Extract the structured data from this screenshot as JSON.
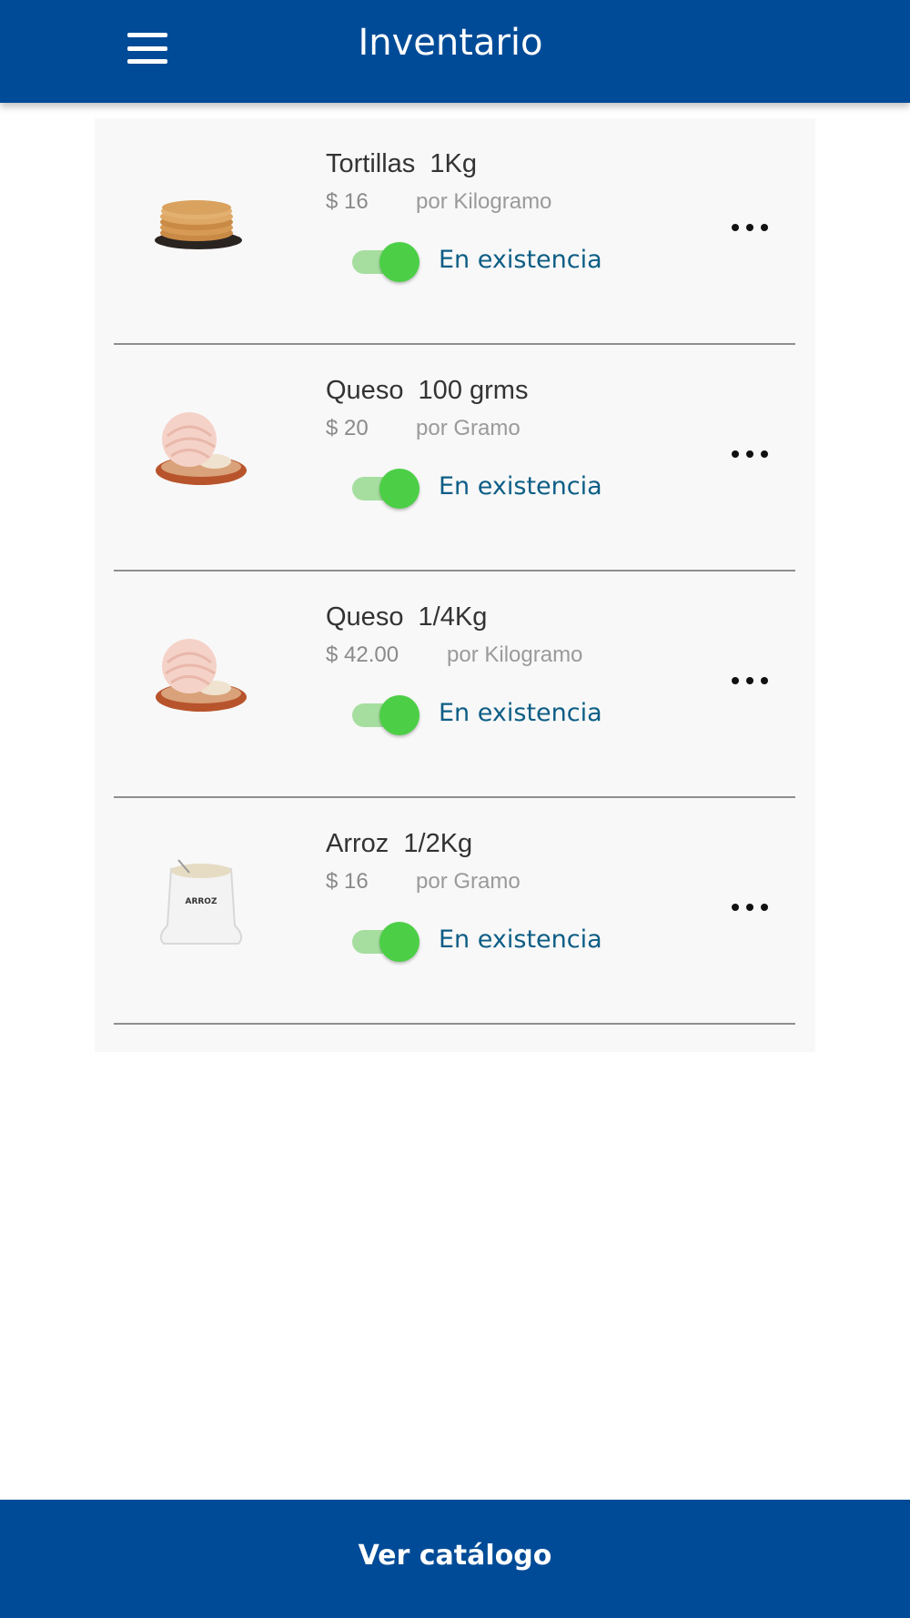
{
  "header": {
    "title": "Inventario",
    "menu_icon": "hamburger-menu-icon",
    "background": "#004b97"
  },
  "items": [
    {
      "name": "Tortillas  1Kg",
      "price": "$ 16",
      "unit": "por Kilogramo",
      "status": "En existencia",
      "in_stock": true,
      "image": "tortillas-image"
    },
    {
      "name": "Queso  100 grms",
      "price": "$ 20",
      "unit": "por Gramo",
      "status": "En existencia",
      "in_stock": true,
      "image": "cheese-image"
    },
    {
      "name": "Queso  1/4Kg",
      "price": "$ 42.00",
      "unit": "por Kilogramo",
      "status": "En existencia",
      "in_stock": true,
      "image": "cheese-image"
    },
    {
      "name": "Arroz  1/2Kg",
      "price": "$ 16",
      "unit": "por Gramo",
      "status": "En existencia",
      "in_stock": true,
      "image": "rice-sack-image",
      "image_label": "ARROZ"
    }
  ],
  "footer": {
    "button_label": "Ver catálogo"
  },
  "colors": {
    "primary": "#004b97",
    "toggle_on": "#4ccf46",
    "status_text": "#0c5d85"
  }
}
